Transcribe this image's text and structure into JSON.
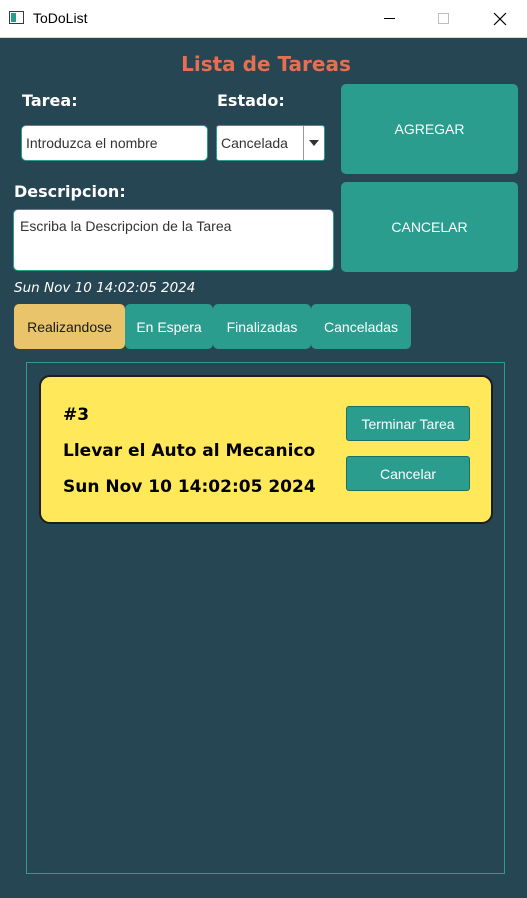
{
  "window": {
    "title": "ToDoList",
    "close_glyph": "✕"
  },
  "header": {
    "title": "Lista de Tareas"
  },
  "form": {
    "task_label": "Tarea:",
    "task_placeholder": "Introduzca el nombre",
    "status_label": "Estado:",
    "status_value": "Cancelada",
    "description_label": "Descripcion:",
    "description_placeholder": "Escriba la Descripcion de la Tarea",
    "add_label": "AGREGAR",
    "cancel_label": "CANCELAR",
    "timestamp": "Sun Nov 10 14:02:05 2024"
  },
  "tabs": [
    {
      "label": "Realizandose",
      "active": true
    },
    {
      "label": "En Espera",
      "active": false
    },
    {
      "label": "Finalizadas",
      "active": false
    },
    {
      "label": "Canceladas",
      "active": false
    }
  ],
  "tasks": [
    {
      "id": "#3",
      "name": "Llevar el Auto al Mecanico",
      "date": "Sun Nov 10 14:02:05 2024",
      "finish_label": "Terminar Tarea",
      "cancel_label": "Cancelar"
    }
  ],
  "icons": {
    "app": "app-window-icon",
    "minimize": "minimize-icon",
    "maximize": "maximize-icon",
    "close": "close-icon",
    "dropdown": "chevron-down-icon"
  },
  "colors": {
    "background": "#264653",
    "accent": "#2a9d8f",
    "title": "#e76f51",
    "active_tab": "#e9c46a",
    "card": "#ffe95a"
  }
}
